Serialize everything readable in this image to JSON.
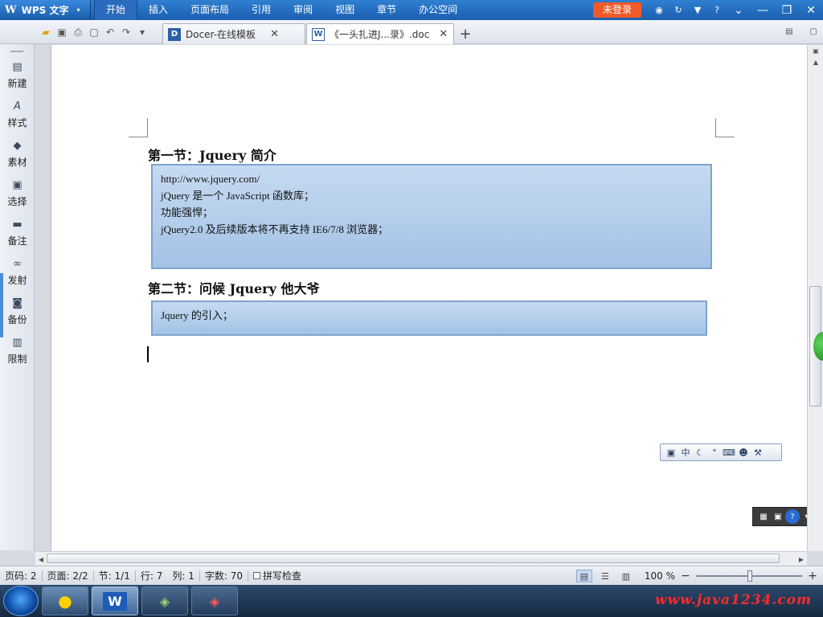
{
  "app": {
    "logo": "W",
    "name": "WPS 文字",
    "dropdown": "▾"
  },
  "menu_tabs": [
    {
      "label": "开始",
      "active": true
    },
    {
      "label": "插入",
      "active": false
    },
    {
      "label": "页面布局",
      "active": false
    },
    {
      "label": "引用",
      "active": false
    },
    {
      "label": "审阅",
      "active": false
    },
    {
      "label": "视图",
      "active": false
    },
    {
      "label": "章节",
      "active": false
    },
    {
      "label": "办公空间",
      "active": false
    }
  ],
  "title_right": {
    "login_label": "未登录",
    "help": "?"
  },
  "tabs": [
    {
      "icon_letter": "D",
      "label": "Docer-在线模板",
      "close": "✕",
      "active": false
    },
    {
      "icon_letter": "W",
      "label": "《一头扎进J...录》.doc",
      "close": "✕",
      "active": true
    }
  ],
  "new_tab": "+",
  "sidebar": [
    {
      "label": "新建",
      "icon": "new-doc-icon",
      "glyph": "▤"
    },
    {
      "label": "样式",
      "icon": "style-icon",
      "glyph": "A"
    },
    {
      "label": "素材",
      "icon": "material-icon",
      "glyph": "◆"
    },
    {
      "label": "选择",
      "icon": "select-icon",
      "glyph": "▣"
    },
    {
      "label": "备注",
      "icon": "note-icon",
      "glyph": "▬"
    },
    {
      "label": "发射",
      "icon": "link-icon",
      "glyph": "∞"
    },
    {
      "label": "备份",
      "icon": "backup-icon",
      "glyph": "◙"
    },
    {
      "label": "限制",
      "icon": "restrict-icon",
      "glyph": "▥"
    }
  ],
  "document": {
    "section1": {
      "title": "第一节：Jquery 简介",
      "lines": [
        "http://www.jquery.com/",
        "jQuery  是一个  JavaScript 函数库；",
        "功能强悍；",
        "jQuery2.0 及后续版本将不再支持 IE6/7/8 浏览器；"
      ]
    },
    "section2": {
      "title": "第二节：问候 Jquery 他大爷",
      "lines": [
        "Jquery 的引入；"
      ]
    }
  },
  "ime_bar": {
    "mode": "中"
  },
  "status": {
    "page_count": "页码: 2",
    "pages": "页面: 2/2",
    "section": "节: 1/1",
    "row": "行: 7",
    "col": "列: 1",
    "words": "字数: 70",
    "spell": "拼写检查",
    "zoom": "100 %",
    "zoom_level_percent": 100
  },
  "taskbar": {
    "wps_label": "W"
  },
  "watermark": "www.java1234.com",
  "colors": {
    "titlebar": "#1b5fb0",
    "login": "#f05a28",
    "codebox": "#a3c2e6",
    "watermark": "#ff2a2a"
  }
}
